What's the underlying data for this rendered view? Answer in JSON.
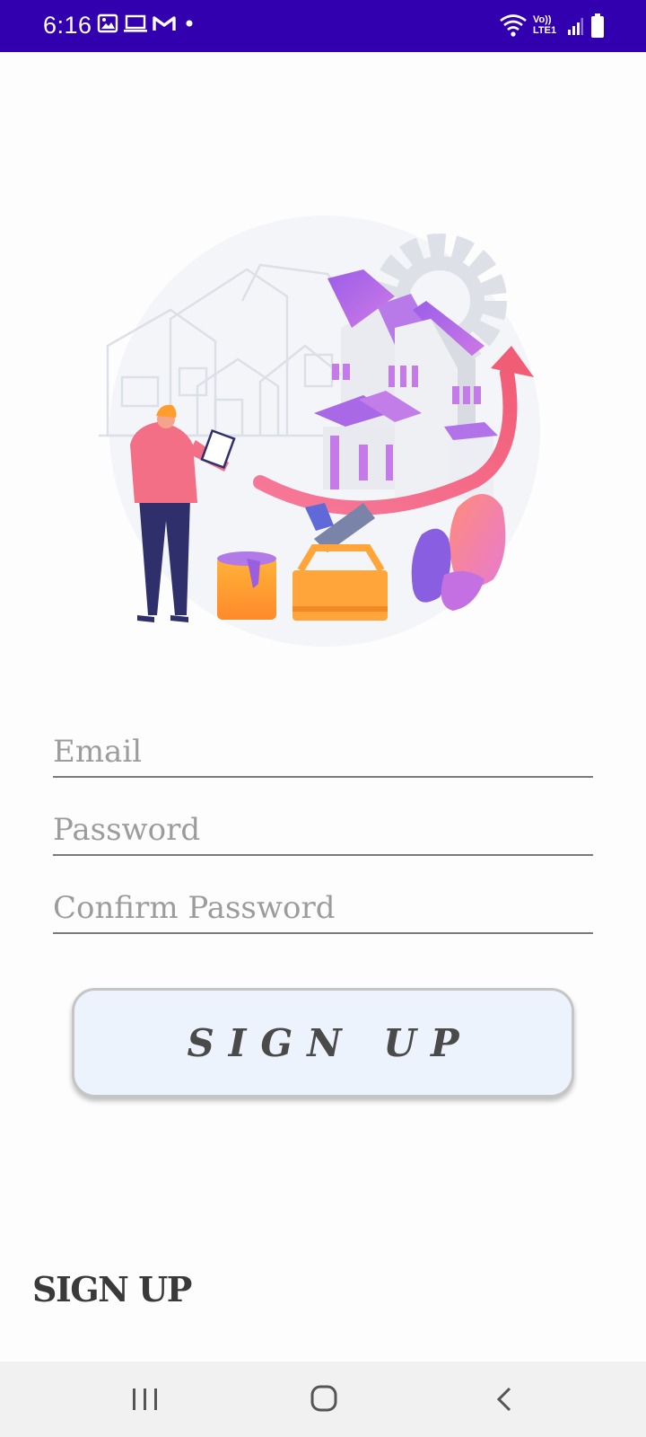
{
  "status_bar": {
    "time": "6:16",
    "network_label": "Vo)) LTE1",
    "icons": [
      "gallery-icon",
      "laptop-icon",
      "gmail-icon",
      "notification-dot-icon",
      "wifi-icon",
      "signal-icon",
      "battery-icon"
    ]
  },
  "form": {
    "email_placeholder": "Email",
    "password_placeholder": "Password",
    "confirm_password_placeholder": "Confirm Password",
    "email_value": "",
    "password_value": "",
    "confirm_password_value": ""
  },
  "signup_button_label": "SIGN UP",
  "page_title": "SIGN UP",
  "colors": {
    "status_bar": "#3300b0",
    "button_bg": "#edf3fd",
    "accent_purple": "#b36be6",
    "accent_pink": "#f26d7d"
  }
}
